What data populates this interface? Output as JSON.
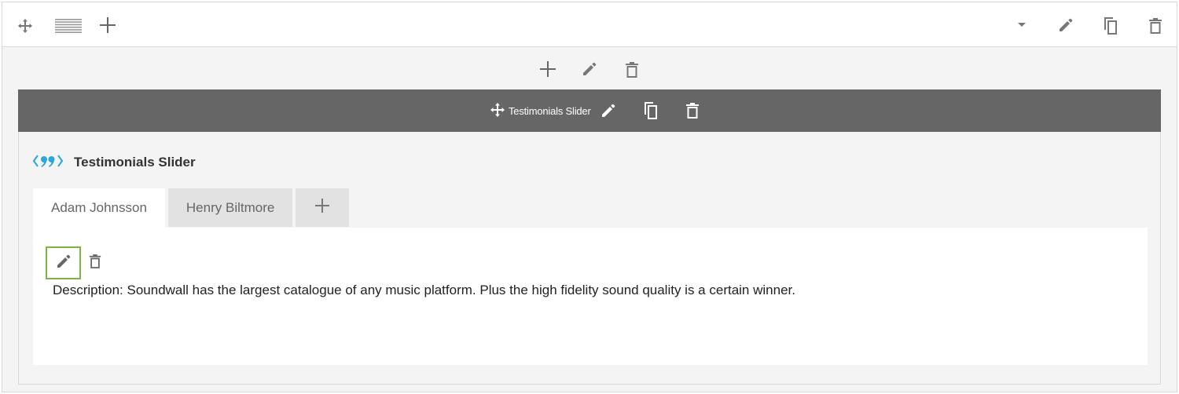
{
  "top_toolbar": {
    "icons": [
      "move-icon",
      "row-layout-icon",
      "plus-icon",
      "dropdown-arrow-icon",
      "pencil-icon",
      "duplicate-icon",
      "trash-icon"
    ]
  },
  "row_actions": {
    "icons": [
      "plus-icon",
      "pencil-icon",
      "trash-icon"
    ]
  },
  "module_bar": {
    "title": "Testimonials Slider",
    "icons": [
      "move-icon",
      "pencil-icon",
      "duplicate-icon",
      "trash-icon"
    ]
  },
  "widget": {
    "icon": "quote-icon",
    "name": "Testimonials Slider",
    "accent_color": "#29a8e0"
  },
  "tabs": [
    {
      "label": "Adam Johnsson",
      "active": true
    },
    {
      "label": "Henry Biltmore",
      "active": false
    }
  ],
  "panel": {
    "description_label": "Description:",
    "description_text": "Soundwall has the largest catalogue of any music platform. Plus the high fidelity sound quality is a certain winner.",
    "edit_border_color": "#7cb342"
  }
}
